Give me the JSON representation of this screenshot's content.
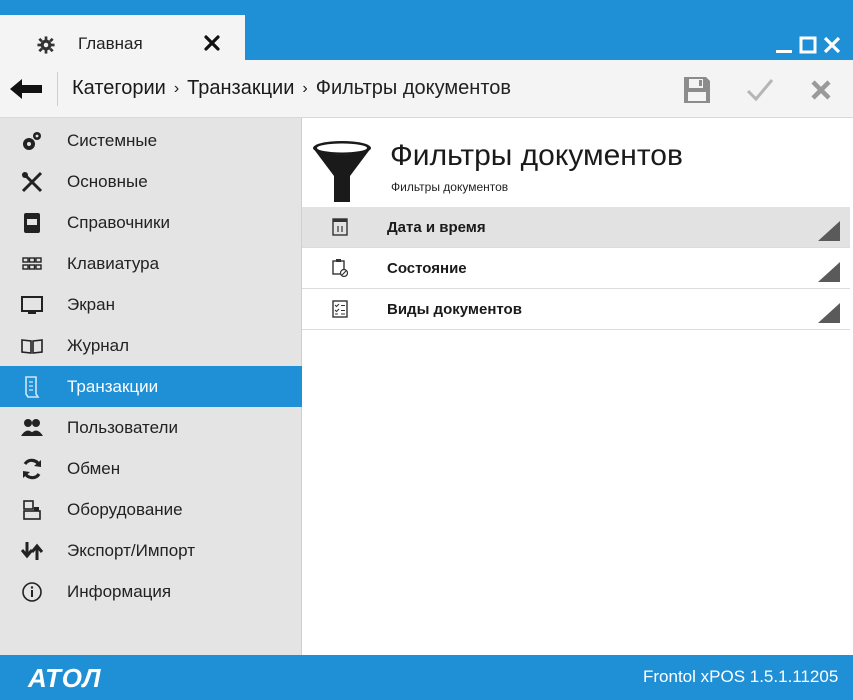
{
  "title_bar": {
    "tab_label": "Главная",
    "tab_icon": "gear-icon",
    "window_controls": [
      "minimize-icon",
      "maximize-icon",
      "close-icon"
    ]
  },
  "breadcrumb": {
    "items": [
      "Категории",
      "Транзакции",
      "Фильтры документов"
    ],
    "separator": "›",
    "toolbar": [
      "save-icon",
      "check-icon",
      "cancel-icon"
    ]
  },
  "sidebar": {
    "items": [
      {
        "label": "Системные",
        "icon": "gears-icon",
        "active": false
      },
      {
        "label": "Основные",
        "icon": "tools-icon",
        "active": false
      },
      {
        "label": "Справочники",
        "icon": "book-icon",
        "active": false
      },
      {
        "label": "Клавиатура",
        "icon": "keyboard-icon",
        "active": false
      },
      {
        "label": "Экран",
        "icon": "monitor-icon",
        "active": false
      },
      {
        "label": "Журнал",
        "icon": "journal-icon",
        "active": false
      },
      {
        "label": "Транзакции",
        "icon": "receipt-icon",
        "active": true
      },
      {
        "label": "Пользователи",
        "icon": "users-icon",
        "active": false
      },
      {
        "label": "Обмен",
        "icon": "sync-icon",
        "active": false
      },
      {
        "label": "Оборудование",
        "icon": "cash-register-icon",
        "active": false
      },
      {
        "label": "Экспорт/Импорт",
        "icon": "export-import-icon",
        "active": false
      },
      {
        "label": "Информация",
        "icon": "info-icon",
        "active": false
      }
    ]
  },
  "main": {
    "title": "Фильтры документов",
    "subtitle": "Фильтры документов",
    "header_icon": "funnel-icon",
    "rows": [
      {
        "label": "Дата и время",
        "icon": "calendar-icon",
        "selected": true
      },
      {
        "label": "Состояние",
        "icon": "clipboard-status-icon",
        "selected": false
      },
      {
        "label": "Виды документов",
        "icon": "checklist-icon",
        "selected": false
      }
    ]
  },
  "footer": {
    "logo": "АТОЛ",
    "version": "Frontol xPOS 1.5.1.11205"
  },
  "colors": {
    "accent": "#1f8fd6",
    "sidebar_bg": "#e4e4e4",
    "toolbar_bg": "#f4f4f4",
    "selected_row": "#e2e2e2"
  }
}
